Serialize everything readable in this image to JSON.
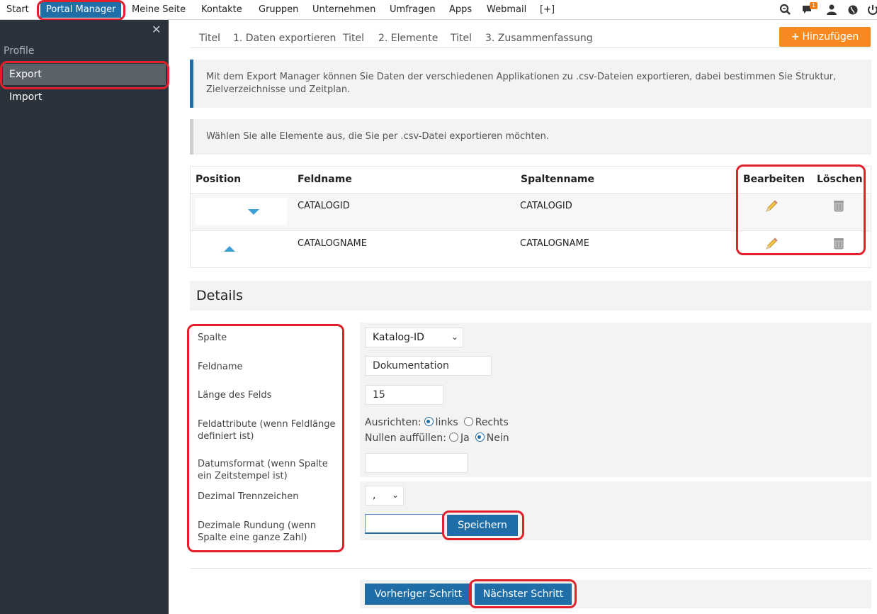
{
  "topnav": {
    "items": [
      "Start",
      "Portal Manager",
      "Meine Seite",
      "Kontakte",
      "Gruppen",
      "Unternehmen",
      "Umfragen",
      "Apps",
      "Webmail",
      "[+]"
    ],
    "notification_count": "1"
  },
  "sidebar": {
    "close": "✕",
    "heading": "Profile",
    "items": [
      "Export",
      "Import"
    ]
  },
  "steps": [
    "Titel",
    "1. Daten exportieren",
    "Titel",
    "2. Elemente",
    "Titel",
    "3. Zusammenfassung"
  ],
  "add_button": "Hinzufügen",
  "info_text": "Mit dem Export Manager können Sie Daten der verschiedenen Applikationen zu .csv-Dateien exportieren, dabei bestimmen Sie Struktur, Zielverzeichnisse und Zeitplan.",
  "select_text": "Wählen Sie alle Elemente aus, die Sie per .csv-Datei exportieren möchten.",
  "table": {
    "headers": [
      "Position",
      "Feldname",
      "Spaltenname",
      "Bearbeiten",
      "Löschen"
    ],
    "rows": [
      {
        "feldname": "CATALOGID",
        "spaltenname": "CATALOGID"
      },
      {
        "feldname": "CATALOGNAME",
        "spaltenname": "CATALOGNAME"
      }
    ]
  },
  "details": {
    "title": "Details",
    "labels": {
      "spalte": "Spalte",
      "feldname": "Feldname",
      "laenge": "Länge des Felds",
      "feldattribute": "Feldattribute (wenn Feldlänge definiert ist)",
      "datumsformat": "Datumsformat (wenn Spalte ein Zeitstempel ist)",
      "dezimal_trenn": "Dezimal Trennzeichen",
      "dezimal_rund": "Dezimale Rundung (wenn Spalte eine ganze Zahl)"
    },
    "spalte_value": "Katalog-ID",
    "feldname_value": "Dokumentation",
    "laenge_value": "15",
    "ausrichten_label": "Ausrichten:",
    "ausrichten_options": [
      "links",
      "Rechts"
    ],
    "nullen_label": "Nullen auffüllen:",
    "nullen_options": [
      "Ja",
      "Nein"
    ],
    "datumsformat_value": "",
    "trennzeichen_value": ",",
    "rundung_value": "",
    "save_button": "Speichern"
  },
  "footer": {
    "prev_button": "Vorheriger Schritt",
    "next_button": "Nächster Schritt"
  },
  "colors": {
    "primary": "#1f6ea8",
    "accent": "#f6891f",
    "highlight": "#e0202a",
    "sidebar": "#2b323b"
  }
}
